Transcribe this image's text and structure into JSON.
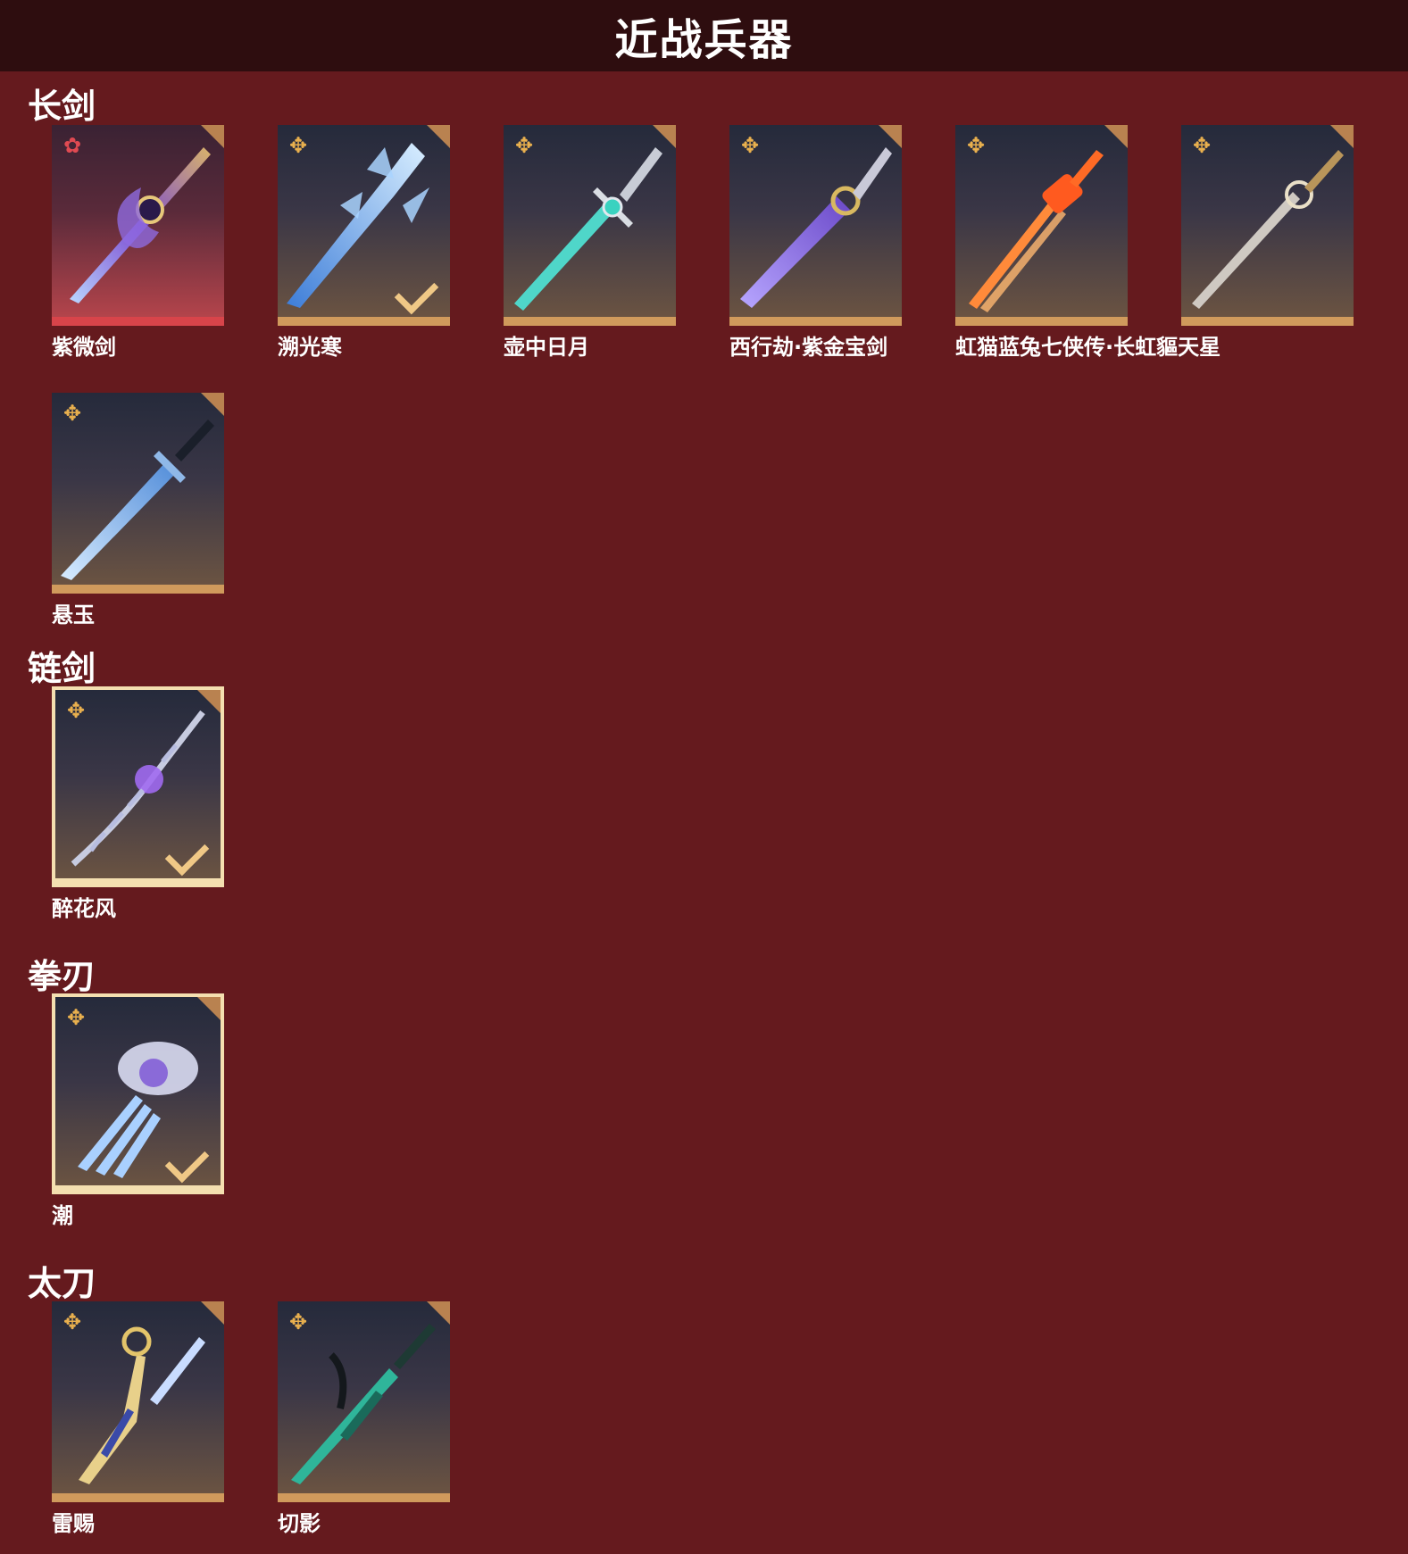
{
  "title": "近战兵器",
  "categories": [
    {
      "name": "长剑",
      "items": [
        {
          "name": "紫微剑",
          "star_icon": "red-star-icon"
        },
        {
          "name": "溯光寒",
          "star_icon": "gold-star-icon",
          "checked": true
        },
        {
          "name": "壶中日月",
          "star_icon": "gold-star-icon"
        },
        {
          "name": "西行劫·紫金宝剑",
          "star_icon": "gold-star-icon"
        },
        {
          "name": "虹猫蓝兔七侠传·长虹貙天星",
          "star_icon": "gold-star-icon"
        },
        {
          "name": "",
          "star_icon": "gold-star-icon"
        },
        {
          "name": "悬玉",
          "star_icon": "gold-star-icon"
        }
      ]
    },
    {
      "name": "链剑",
      "items": [
        {
          "name": "醉花风",
          "star_icon": "gold-star-icon",
          "checked": true,
          "selected": true
        }
      ]
    },
    {
      "name": "拳刃",
      "items": [
        {
          "name": "潮",
          "star_icon": "gold-star-icon",
          "checked": true,
          "selected": true
        }
      ]
    },
    {
      "name": "太刀",
      "items": [
        {
          "name": "雷赐",
          "star_icon": "gold-star-icon"
        },
        {
          "name": "切影",
          "star_icon": "gold-star-icon"
        }
      ]
    }
  ],
  "colors": {
    "background": "#651a1e",
    "header": "#2e0d0f",
    "card_border": "#d09a5c",
    "selected_border": "#f4dfb0",
    "gold_star": "#e9b04e",
    "red_star": "#e04a52"
  }
}
